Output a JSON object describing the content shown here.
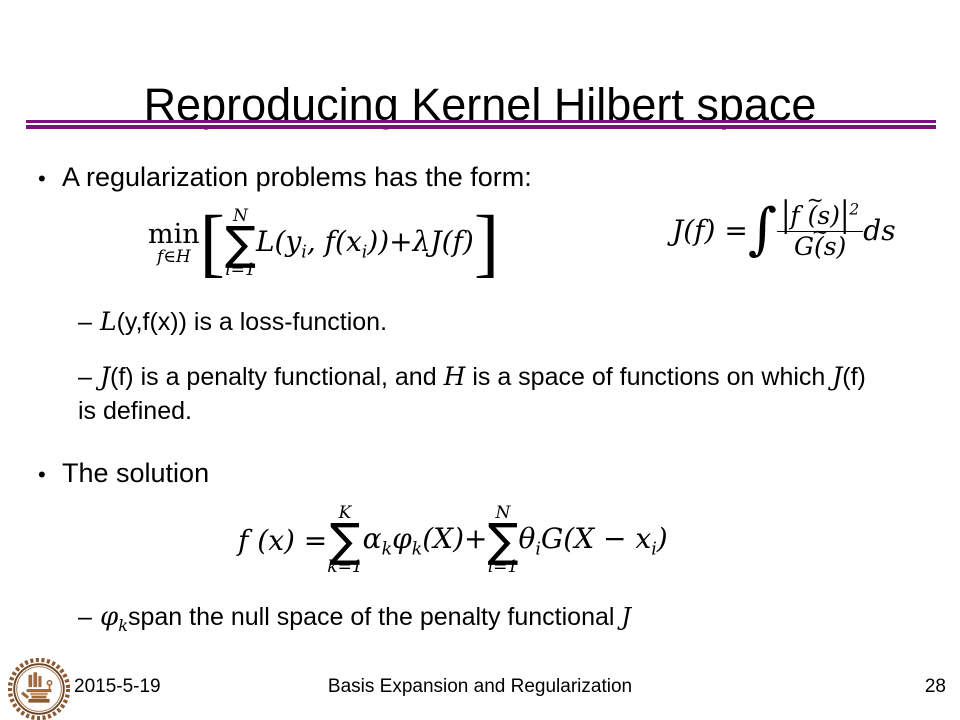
{
  "slide": {
    "title": "Reproducing Kernel Hilbert space",
    "accent_color": "#7b0f7b",
    "background_color": "#ffffff",
    "text_color": "#000000"
  },
  "body": {
    "bullet_regularization": {
      "marker": "•",
      "text": "A regularization problems has the form:"
    },
    "bullet_loss_function": {
      "marker": "–",
      "symbol": "L",
      "text": "(y,f(x))  is a loss-function."
    },
    "bullet_penalty": {
      "marker": "–",
      "symbol_j": "J",
      "text_part1": "(f) is a penalty functional, and ",
      "symbol_h": "H",
      "text_part2": " is a space of functions on which ",
      "symbol_j2": "J",
      "text_part3": "(f) is defined."
    },
    "bullet_the_solution": {
      "marker": "•",
      "text": "The solution"
    },
    "bullet_span_null": {
      "marker": "–",
      "symbol_phi": "φ",
      "symbol_phi_sub": "k",
      "text": "span the null space of the penalty functional ",
      "symbol_j": "J"
    }
  },
  "equations": {
    "regularization": {
      "min_label": "min",
      "min_sub": "f∈H",
      "bracket_open": "[",
      "sum_upper": "N",
      "sum_symbol": "∑",
      "sum_lower": "i=1",
      "loss_term": "L(y",
      "loss_sub1": "i",
      "loss_mid": ", f(x",
      "loss_sub2": "i",
      "loss_close": "))",
      "plus": "+",
      "lambda_term": "λJ(f)",
      "bracket_close": "]"
    },
    "jf": {
      "lhs": "J(f) =",
      "integral": "∫",
      "numerator_tilde": "~",
      "numerator": "f (s)",
      "numerator_power": "2",
      "denominator_tilde": "~",
      "denominator": "G(s)",
      "differential": "ds"
    },
    "solution": {
      "lhs": "f (x) =",
      "sum1_upper": "K",
      "sum_symbol": "∑",
      "sum1_lower": "k=1",
      "term1_alpha": "α",
      "term1_alpha_sub": "k",
      "term1_phi": "φ",
      "term1_phi_sub": "k",
      "term1_arg": "(X)",
      "plus": "+",
      "sum2_upper": "N",
      "sum2_lower": "i=1",
      "term2_theta": "θ",
      "term2_theta_sub": "i",
      "term2_g": "G(X − x",
      "term2_g_sub": "i",
      "term2_close": ")"
    }
  },
  "footer": {
    "date": "2015-5-19",
    "subject": "Basis Expansion and Regularization",
    "page_number": "28",
    "logo_name": "university-emblem-logo"
  }
}
